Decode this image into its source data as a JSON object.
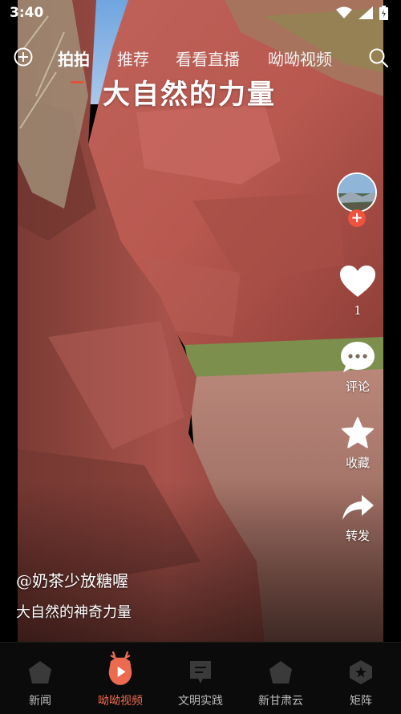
{
  "status_bar": {
    "time": "3:40"
  },
  "top_nav": {
    "tabs": [
      {
        "label": "拍拍",
        "active": true
      },
      {
        "label": "推荐",
        "active": false
      },
      {
        "label": "看看直播",
        "active": false
      },
      {
        "label": "呦呦视频",
        "active": false
      }
    ]
  },
  "video": {
    "title_overlay": "大自然的力量",
    "author": "@奶茶少放糖喔",
    "description": "大自然的神奇力量"
  },
  "actions": {
    "like_count": "1",
    "comment_label": "评论",
    "favorite_label": "收藏",
    "share_label": "转发"
  },
  "bottom_nav": {
    "items": [
      {
        "label": "新闻",
        "icon": "pentagon-icon"
      },
      {
        "label": "呦呦视频",
        "icon": "deer-play-icon",
        "active": true
      },
      {
        "label": "文明实践",
        "icon": "document-icon"
      },
      {
        "label": "新甘肃云",
        "icon": "pentagon-icon"
      },
      {
        "label": "矩阵",
        "icon": "hexagon-star-icon"
      }
    ]
  },
  "colors": {
    "accent": "#ec6a4f",
    "follow": "#f0523d"
  }
}
